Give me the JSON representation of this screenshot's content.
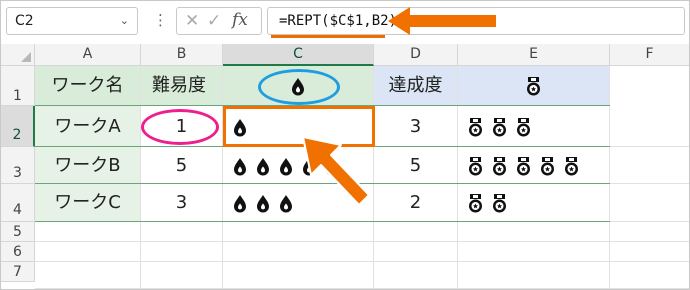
{
  "formula_bar": {
    "name_box": "C2",
    "name_chevron": "⌄",
    "more_dots": "⋮",
    "cancel": "✕",
    "enter": "✓",
    "fx": "fx",
    "formula": "=REPT($C$1,B2)"
  },
  "columns": [
    "A",
    "B",
    "C",
    "D",
    "E",
    "F"
  ],
  "rows": [
    "1",
    "2",
    "3",
    "4",
    "5",
    "6",
    "7"
  ],
  "selected": {
    "column": "C",
    "row": "2"
  },
  "header": {
    "a": "ワーク名",
    "b": "難易度",
    "c_icon": "drop-icon",
    "d": "達成度",
    "e_icon": "medal-icon"
  },
  "table": [
    {
      "name": "ワークA",
      "difficulty": "1",
      "drops": 1,
      "achievement": "3",
      "medals": 3
    },
    {
      "name": "ワークB",
      "difficulty": "5",
      "drops": 5,
      "achievement": "5",
      "medals": 5
    },
    {
      "name": "ワークC",
      "difficulty": "3",
      "drops": 3,
      "achievement": "2",
      "medals": 2
    }
  ],
  "colors": {
    "header_green": "#d9ecd9",
    "header_blue": "#dbe5f5",
    "selection": "#1f7a47",
    "annotation_orange": "#f07000",
    "annotation_pink": "#ef1d8d",
    "annotation_blue": "#1e9ee0"
  }
}
